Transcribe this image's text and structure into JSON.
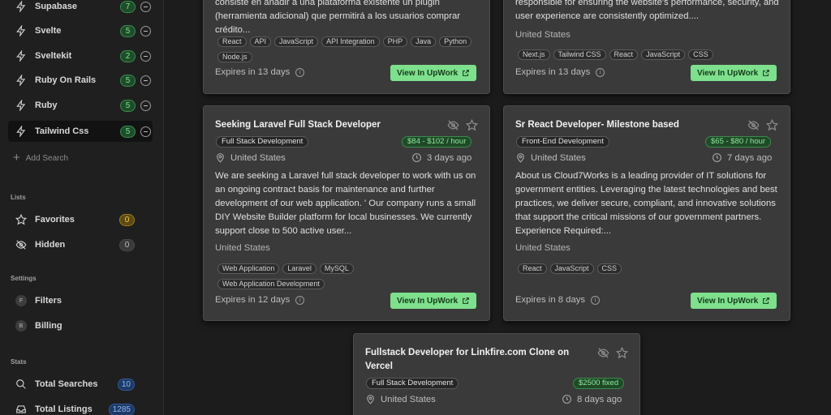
{
  "sidebar": {
    "searches": [
      {
        "label": "Supabase",
        "count": "7"
      },
      {
        "label": "Svelte",
        "count": "5"
      },
      {
        "label": "Sveltekit",
        "count": "2"
      },
      {
        "label": "Ruby On Rails",
        "count": "5"
      },
      {
        "label": "Ruby",
        "count": "5"
      },
      {
        "label": "Tailwind Css",
        "count": "5"
      }
    ],
    "add_search": "Add Search",
    "lists_title": "Lists",
    "lists": [
      {
        "label": "Favorites",
        "count": "0"
      },
      {
        "label": "Hidden",
        "count": "0"
      }
    ],
    "settings_title": "Settings",
    "settings": [
      {
        "letter": "F",
        "label": "Filters"
      },
      {
        "letter": "B",
        "label": "Billing"
      }
    ],
    "stats_title": "Stats",
    "stats": [
      {
        "label": "Total Searches",
        "count": "10"
      },
      {
        "label": "Total Listings",
        "count": "1285"
      }
    ]
  },
  "cards": [
    {
      "desc": "consiste en añadir a una plataforma existente un plugin (herramienta adicional) que permitirá a los usuarios comprar crédito...",
      "tags": [
        "React",
        "API",
        "JavaScript",
        "API Integration",
        "PHP",
        "Java",
        "Python",
        "Node.js"
      ],
      "expires": "Expires in 13 days",
      "button": "View In UpWork"
    },
    {
      "desc": "responsible for ensuring the website's performance, security, and user experience are consistently optimized....",
      "location": "United States",
      "tags": [
        "Next.js",
        "Tailwind CSS",
        "React",
        "JavaScript",
        "CSS"
      ],
      "expires": "Expires in 13 days",
      "button": "View In UpWork"
    },
    {
      "title": "Seeking Laravel Full Stack Developer",
      "category": "Full Stack Development",
      "price": "$84 - $102 / hour",
      "country": "United States",
      "posted": "3 days ago",
      "desc": "We are seeking a Laravel full stack developer to work with us on an ongoing contract basis for maintenance and further development of our web application. ' Our company runs a small DIY Website Builder platform for local businesses. We currently support close to 500 active user...",
      "location": "United States",
      "tags": [
        "Web Application",
        "Laravel",
        "MySQL",
        "Web Application Development"
      ],
      "expires": "Expires in 12 days",
      "button": "View In UpWork"
    },
    {
      "title": "Sr React Developer- Milestone based",
      "category": "Front-End Development",
      "price": "$65 - $80 / hour",
      "country": "United States",
      "posted": "7 days ago",
      "desc": "About us Cloud7Works is a leading provider of IT solutions for government entities. Leveraging the latest technologies and best practices, we deliver secure, compliant, and innovative solutions that support the critical missions of our government partners. Experience Required:...",
      "location": "United States",
      "tags": [
        "React",
        "JavaScript",
        "CSS"
      ],
      "expires": "Expires in 8 days",
      "button": "View In UpWork"
    },
    {
      "title": "Fullstack Developer for Linkfire.com Clone on Vercel",
      "category": "Full Stack Development",
      "price": "$2500 fixed",
      "country": "United States",
      "posted": "8 days ago"
    }
  ]
}
